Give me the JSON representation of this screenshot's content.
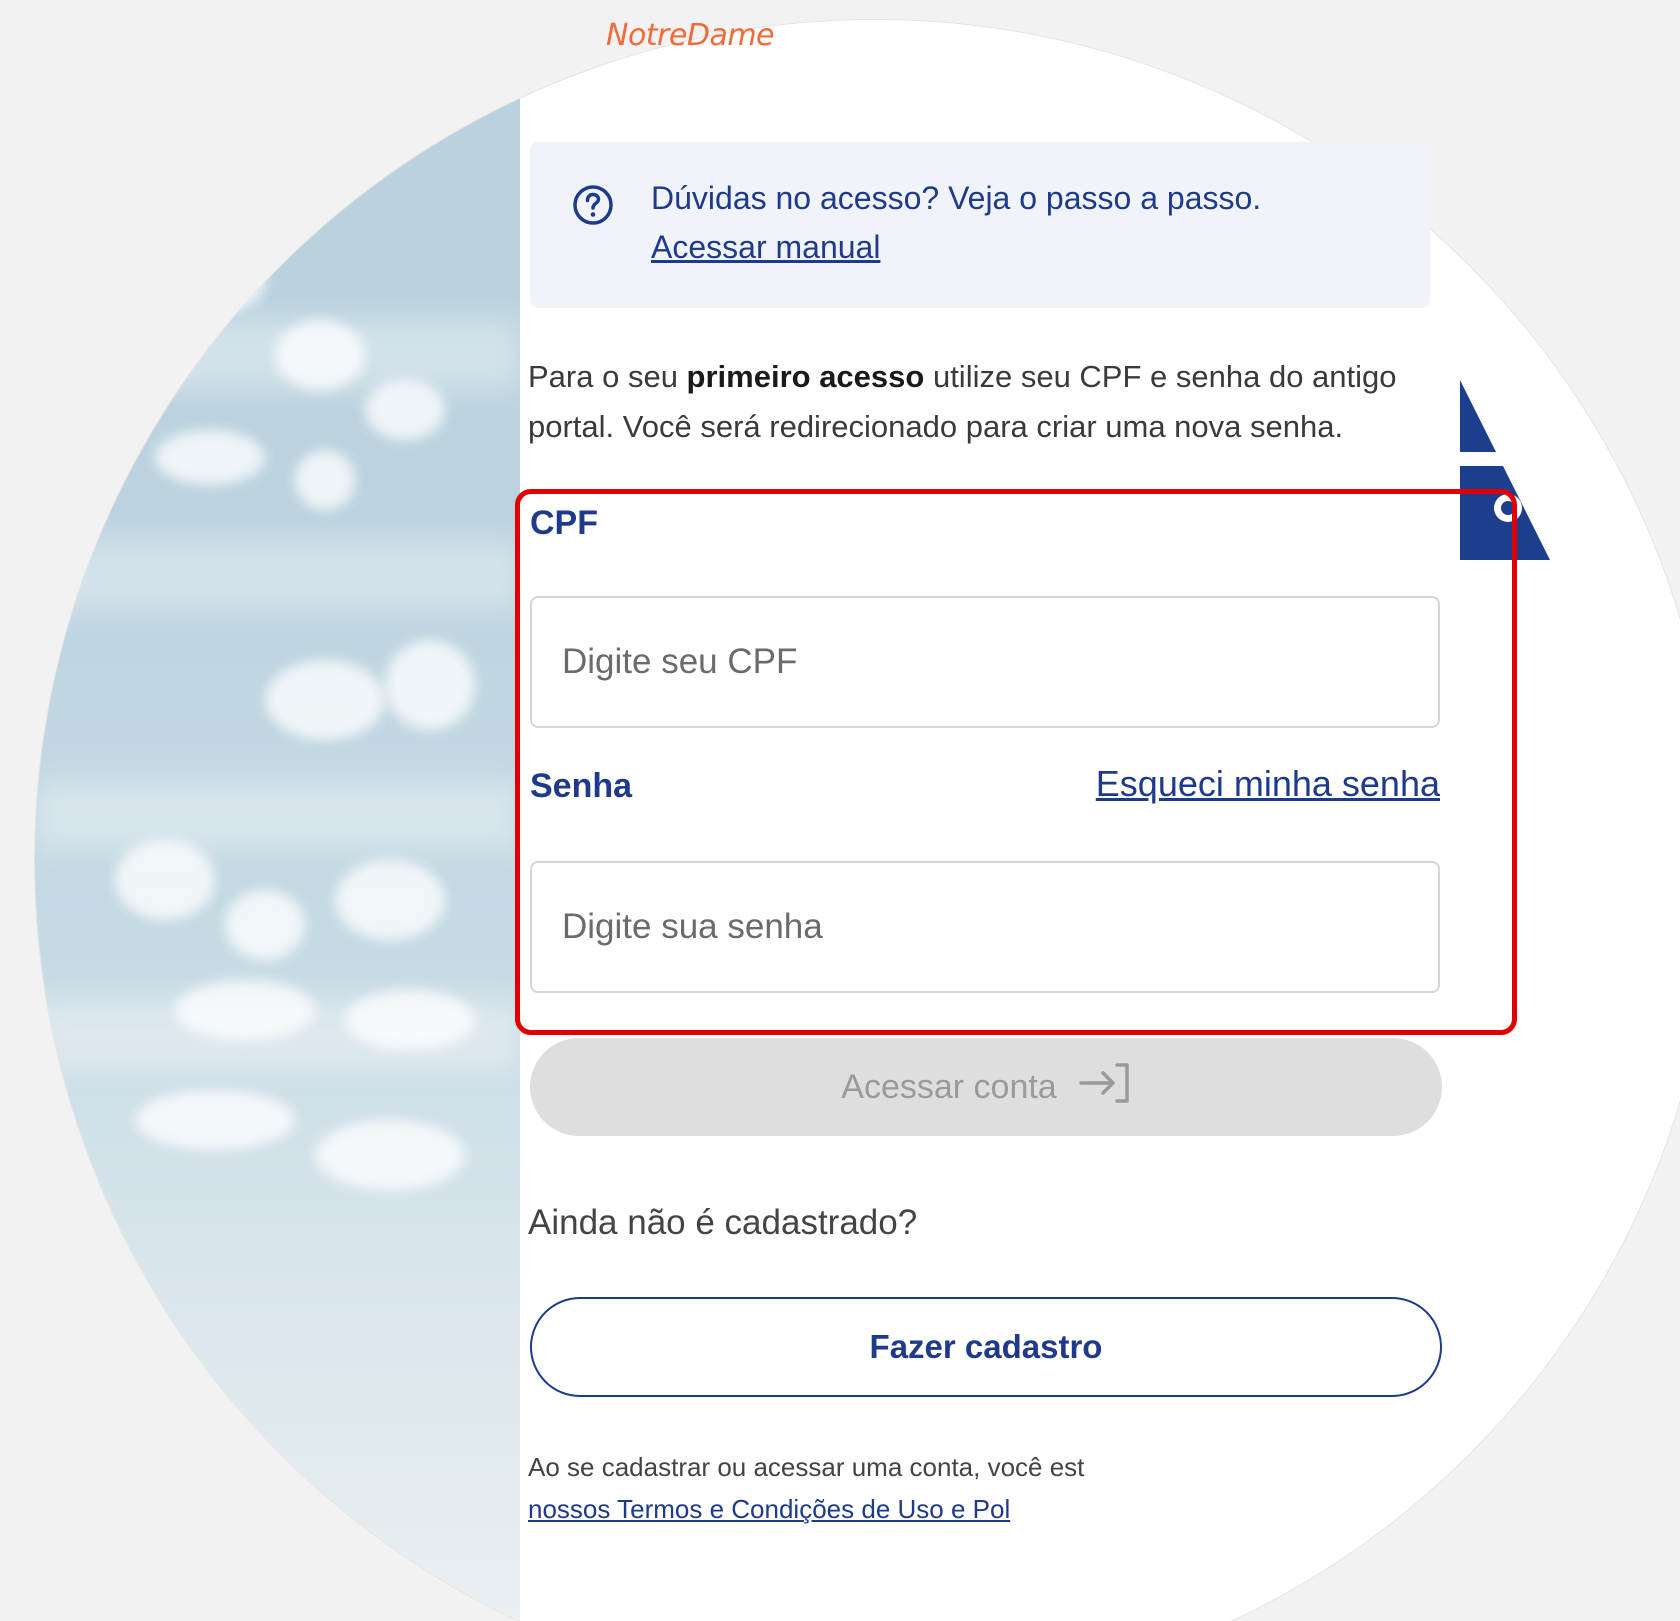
{
  "brand": {
    "logo_text": "NotreDame",
    "accent": "#f26a3a",
    "primary": "#1e3a8a"
  },
  "help": {
    "icon": "question-circle-icon",
    "title": "Dúvidas no acesso? Veja o passo a passo.",
    "link": "Acessar manual"
  },
  "intro": {
    "prefix": "Para o seu ",
    "bold": "primeiro acesso",
    "suffix": " utilize seu CPF e senha do antigo portal. Você será redirecionado para criar uma nova senha."
  },
  "form": {
    "cpf_label": "CPF",
    "cpf_placeholder": "Digite seu CPF",
    "password_label": "Senha",
    "forgot_link": "Esqueci minha senha",
    "password_placeholder": "Digite sua senha",
    "submit_label": "Acessar conta",
    "submit_icon": "login-arrow-icon"
  },
  "register": {
    "question": "Ainda não é cadastrado?",
    "button_label": "Fazer cadastro"
  },
  "terms": {
    "text": "Ao se cadastrar ou acessar uma conta, você est",
    "link": "nossos Termos e Condições de Uso e Pol"
  },
  "highlight_color": "#e10000"
}
